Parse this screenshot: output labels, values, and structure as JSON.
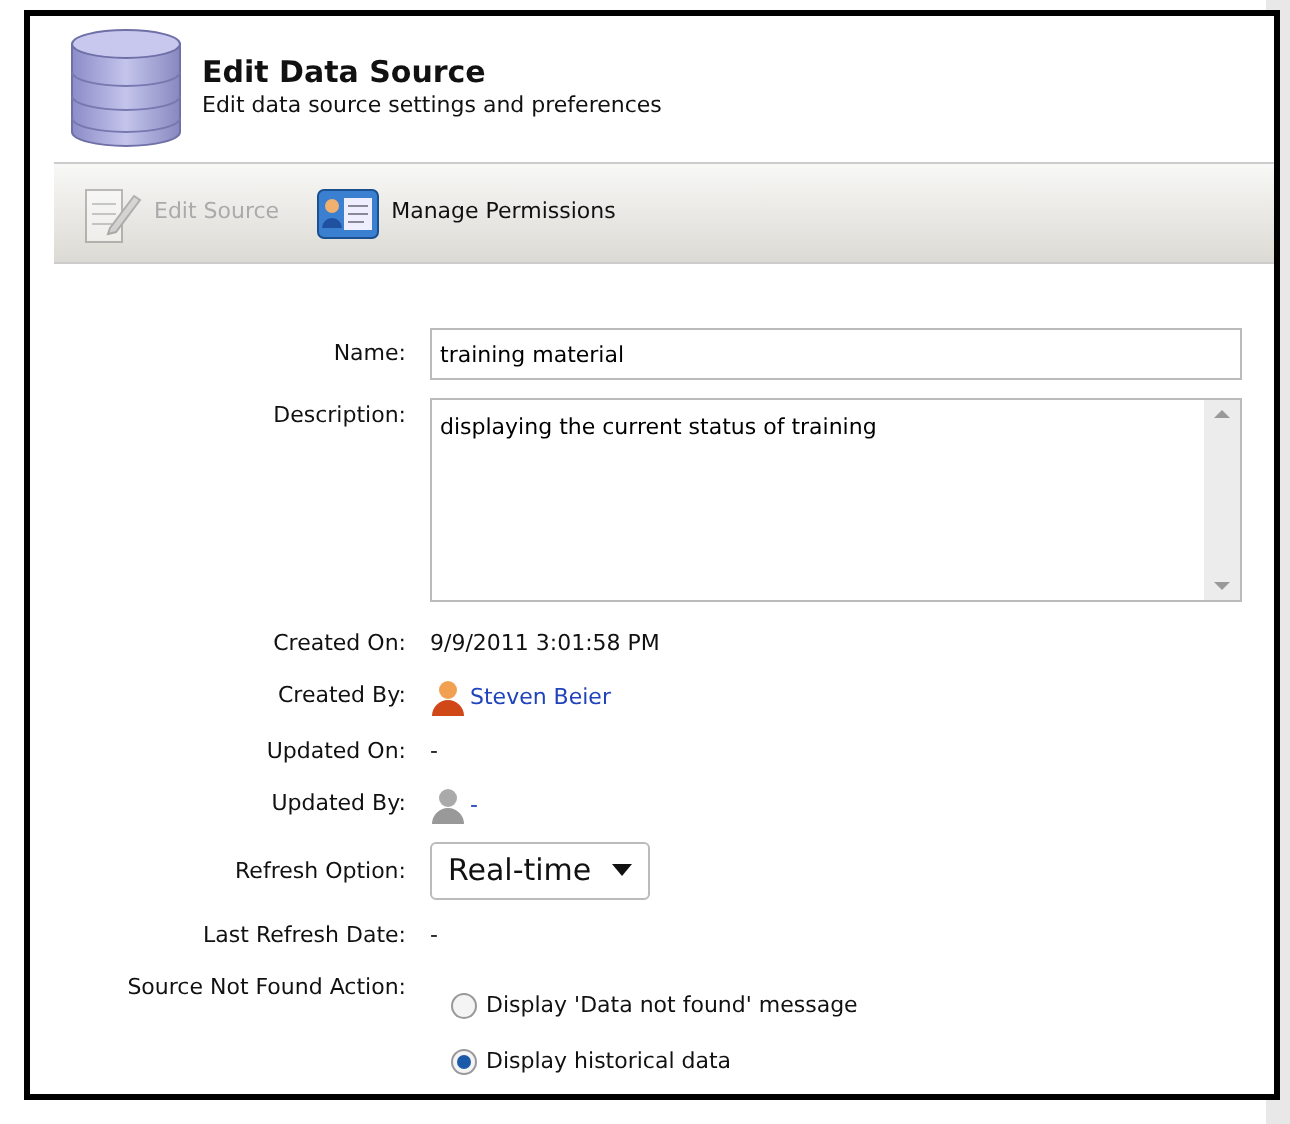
{
  "header": {
    "title": "Edit Data Source",
    "subtitle": "Edit data source settings and preferences"
  },
  "toolbar": [
    {
      "label": "Edit Source",
      "kind": "edit",
      "disabled": true
    },
    {
      "label": "Manage Permissions",
      "kind": "permissions",
      "disabled": false
    }
  ],
  "fields": [
    {
      "label": "Name:",
      "kind": "input",
      "value": "training material"
    },
    {
      "label": "Description:",
      "kind": "textarea",
      "value": "displaying the current status of training"
    },
    {
      "label": "Created On:",
      "kind": "text",
      "value": "9/9/2011 3:01:58 PM"
    },
    {
      "label": "Created By:",
      "kind": "user",
      "value": "Steven Beier",
      "known": true
    },
    {
      "label": "Updated On:",
      "kind": "text",
      "value": "-"
    },
    {
      "label": "Updated By:",
      "kind": "user",
      "value": "-",
      "known": false
    },
    {
      "label": "Refresh Option:",
      "kind": "select",
      "value": "Real-time"
    },
    {
      "label": "Last Refresh Date:",
      "kind": "text",
      "value": "-"
    },
    {
      "label": "Source Not Found Action:",
      "kind": "radios",
      "options": [
        {
          "label": "Display 'Data not found' message",
          "selected": false
        },
        {
          "label": "Display historical data",
          "selected": true
        }
      ]
    }
  ]
}
